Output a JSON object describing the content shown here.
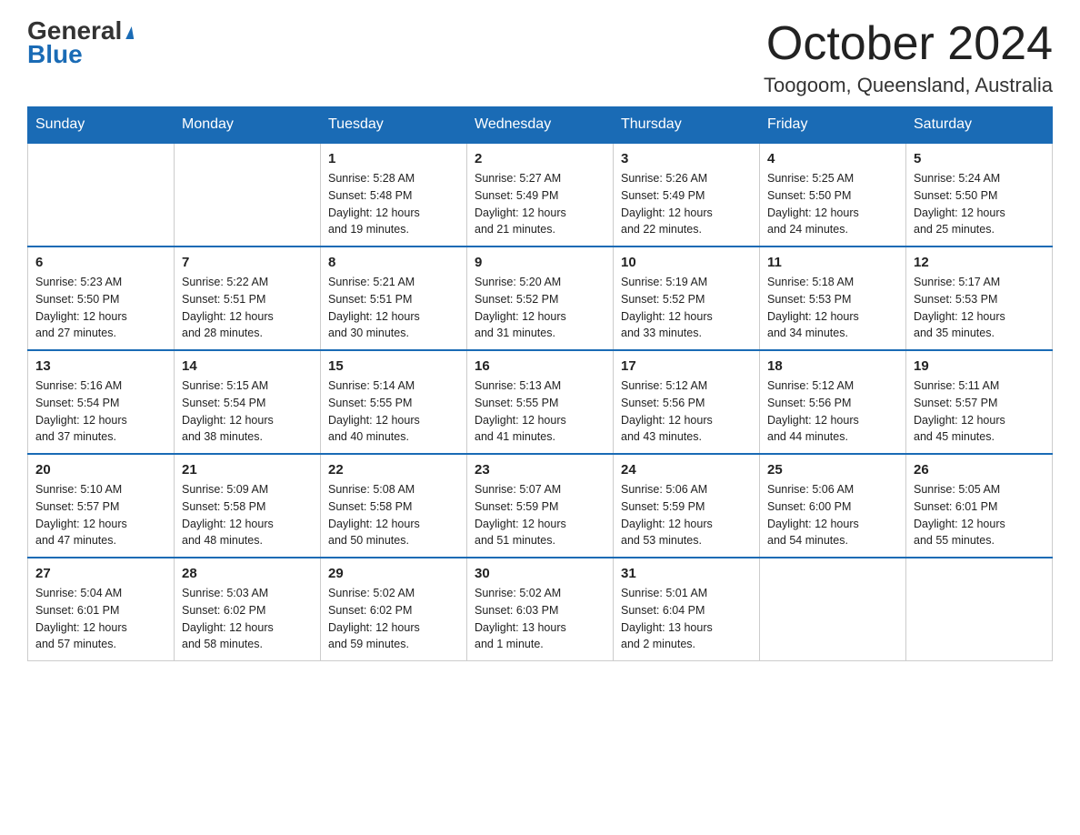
{
  "header": {
    "logo_general": "General",
    "logo_blue": "Blue",
    "month_title": "October 2024",
    "location": "Toogoom, Queensland, Australia"
  },
  "days_of_week": [
    "Sunday",
    "Monday",
    "Tuesday",
    "Wednesday",
    "Thursday",
    "Friday",
    "Saturday"
  ],
  "weeks": [
    [
      {
        "day": "",
        "info": ""
      },
      {
        "day": "",
        "info": ""
      },
      {
        "day": "1",
        "info": "Sunrise: 5:28 AM\nSunset: 5:48 PM\nDaylight: 12 hours\nand 19 minutes."
      },
      {
        "day": "2",
        "info": "Sunrise: 5:27 AM\nSunset: 5:49 PM\nDaylight: 12 hours\nand 21 minutes."
      },
      {
        "day": "3",
        "info": "Sunrise: 5:26 AM\nSunset: 5:49 PM\nDaylight: 12 hours\nand 22 minutes."
      },
      {
        "day": "4",
        "info": "Sunrise: 5:25 AM\nSunset: 5:50 PM\nDaylight: 12 hours\nand 24 minutes."
      },
      {
        "day": "5",
        "info": "Sunrise: 5:24 AM\nSunset: 5:50 PM\nDaylight: 12 hours\nand 25 minutes."
      }
    ],
    [
      {
        "day": "6",
        "info": "Sunrise: 5:23 AM\nSunset: 5:50 PM\nDaylight: 12 hours\nand 27 minutes."
      },
      {
        "day": "7",
        "info": "Sunrise: 5:22 AM\nSunset: 5:51 PM\nDaylight: 12 hours\nand 28 minutes."
      },
      {
        "day": "8",
        "info": "Sunrise: 5:21 AM\nSunset: 5:51 PM\nDaylight: 12 hours\nand 30 minutes."
      },
      {
        "day": "9",
        "info": "Sunrise: 5:20 AM\nSunset: 5:52 PM\nDaylight: 12 hours\nand 31 minutes."
      },
      {
        "day": "10",
        "info": "Sunrise: 5:19 AM\nSunset: 5:52 PM\nDaylight: 12 hours\nand 33 minutes."
      },
      {
        "day": "11",
        "info": "Sunrise: 5:18 AM\nSunset: 5:53 PM\nDaylight: 12 hours\nand 34 minutes."
      },
      {
        "day": "12",
        "info": "Sunrise: 5:17 AM\nSunset: 5:53 PM\nDaylight: 12 hours\nand 35 minutes."
      }
    ],
    [
      {
        "day": "13",
        "info": "Sunrise: 5:16 AM\nSunset: 5:54 PM\nDaylight: 12 hours\nand 37 minutes."
      },
      {
        "day": "14",
        "info": "Sunrise: 5:15 AM\nSunset: 5:54 PM\nDaylight: 12 hours\nand 38 minutes."
      },
      {
        "day": "15",
        "info": "Sunrise: 5:14 AM\nSunset: 5:55 PM\nDaylight: 12 hours\nand 40 minutes."
      },
      {
        "day": "16",
        "info": "Sunrise: 5:13 AM\nSunset: 5:55 PM\nDaylight: 12 hours\nand 41 minutes."
      },
      {
        "day": "17",
        "info": "Sunrise: 5:12 AM\nSunset: 5:56 PM\nDaylight: 12 hours\nand 43 minutes."
      },
      {
        "day": "18",
        "info": "Sunrise: 5:12 AM\nSunset: 5:56 PM\nDaylight: 12 hours\nand 44 minutes."
      },
      {
        "day": "19",
        "info": "Sunrise: 5:11 AM\nSunset: 5:57 PM\nDaylight: 12 hours\nand 45 minutes."
      }
    ],
    [
      {
        "day": "20",
        "info": "Sunrise: 5:10 AM\nSunset: 5:57 PM\nDaylight: 12 hours\nand 47 minutes."
      },
      {
        "day": "21",
        "info": "Sunrise: 5:09 AM\nSunset: 5:58 PM\nDaylight: 12 hours\nand 48 minutes."
      },
      {
        "day": "22",
        "info": "Sunrise: 5:08 AM\nSunset: 5:58 PM\nDaylight: 12 hours\nand 50 minutes."
      },
      {
        "day": "23",
        "info": "Sunrise: 5:07 AM\nSunset: 5:59 PM\nDaylight: 12 hours\nand 51 minutes."
      },
      {
        "day": "24",
        "info": "Sunrise: 5:06 AM\nSunset: 5:59 PM\nDaylight: 12 hours\nand 53 minutes."
      },
      {
        "day": "25",
        "info": "Sunrise: 5:06 AM\nSunset: 6:00 PM\nDaylight: 12 hours\nand 54 minutes."
      },
      {
        "day": "26",
        "info": "Sunrise: 5:05 AM\nSunset: 6:01 PM\nDaylight: 12 hours\nand 55 minutes."
      }
    ],
    [
      {
        "day": "27",
        "info": "Sunrise: 5:04 AM\nSunset: 6:01 PM\nDaylight: 12 hours\nand 57 minutes."
      },
      {
        "day": "28",
        "info": "Sunrise: 5:03 AM\nSunset: 6:02 PM\nDaylight: 12 hours\nand 58 minutes."
      },
      {
        "day": "29",
        "info": "Sunrise: 5:02 AM\nSunset: 6:02 PM\nDaylight: 12 hours\nand 59 minutes."
      },
      {
        "day": "30",
        "info": "Sunrise: 5:02 AM\nSunset: 6:03 PM\nDaylight: 13 hours\nand 1 minute."
      },
      {
        "day": "31",
        "info": "Sunrise: 5:01 AM\nSunset: 6:04 PM\nDaylight: 13 hours\nand 2 minutes."
      },
      {
        "day": "",
        "info": ""
      },
      {
        "day": "",
        "info": ""
      }
    ]
  ]
}
